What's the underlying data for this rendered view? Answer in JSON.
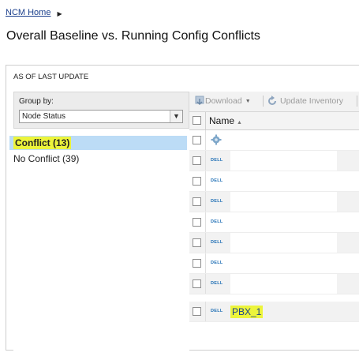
{
  "breadcrumb": {
    "home_label": "NCM Home"
  },
  "page_title": "Overall Baseline vs. Running Config Conflicts",
  "as_of": "AS OF LAST UPDATE",
  "group_by": {
    "label": "Group by:",
    "selected": "Node Status"
  },
  "groups": [
    {
      "label": "Conflict (13)",
      "selected": true
    },
    {
      "label": "No Conflict (39)",
      "selected": false
    }
  ],
  "toolbar": {
    "download_label": "Download",
    "update_inventory_label": "Update Inventory"
  },
  "grid": {
    "name_header": "Name",
    "rows": [
      {
        "icon": "gear-icon",
        "vendor_logo": "",
        "name": ""
      },
      {
        "icon": "dell-logo-icon",
        "vendor_logo": "DELL",
        "name": ""
      },
      {
        "icon": "dell-logo-icon",
        "vendor_logo": "DELL",
        "name": ""
      },
      {
        "icon": "dell-logo-icon",
        "vendor_logo": "DELL",
        "name": ""
      },
      {
        "icon": "dell-logo-icon",
        "vendor_logo": "DELL",
        "name": ""
      },
      {
        "icon": "dell-logo-icon",
        "vendor_logo": "DELL",
        "name": ""
      },
      {
        "icon": "dell-logo-icon",
        "vendor_logo": "DELL",
        "name": ""
      },
      {
        "icon": "dell-logo-icon",
        "vendor_logo": "DELL",
        "name": ""
      },
      {
        "icon": "dell-logo-icon",
        "vendor_logo": "DELL",
        "name": "PBX_1"
      }
    ]
  },
  "colors": {
    "highlight": "#ecf43b",
    "selection": "#bcdcf6",
    "link": "#1a3f8c",
    "dell_blue": "#1f6fb5"
  }
}
